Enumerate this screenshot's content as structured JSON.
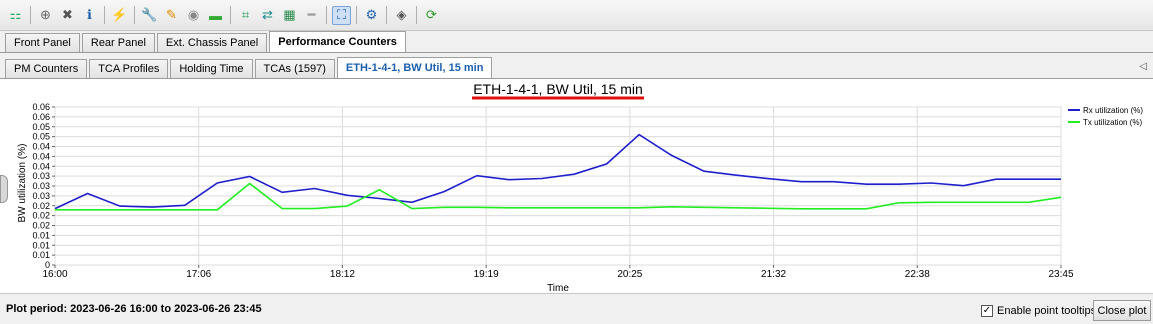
{
  "toolbar": {
    "icons": [
      "network-tree-icon",
      "add-icon",
      "delete-icon",
      "info-icon",
      "lightning-icon",
      "wrench-icon",
      "paint-icon",
      "grey-icon",
      "module-icon",
      "expand-icon",
      "shuffle-icon",
      "ports-icon",
      "bar-icon",
      "chart-icon",
      "refresh-settings-icon",
      "cube-icon",
      "sync-icon"
    ]
  },
  "main_tabs": [
    "Front Panel",
    "Rear Panel",
    "Ext. Chassis Panel",
    "Performance Counters"
  ],
  "sub_tabs": [
    "PM Counters",
    "TCA Profiles",
    "Holding Time",
    "TCAs (1597)",
    "ETH-1-4-1, BW Util, 15 min"
  ],
  "footer": {
    "period": "Plot period: 2023-06-26 16:00 to 2023-06-26 23:45",
    "tooltip_label": "Enable point tooltips",
    "close_label": "Close plot"
  },
  "chart_data": {
    "type": "line",
    "title": "ETH-1-4-1, BW Util, 15 min",
    "xlabel": "Time",
    "ylabel": "BW utilization (%)",
    "x_ticks": [
      "16:00",
      "17:06",
      "18:12",
      "19:19",
      "20:25",
      "21:32",
      "22:38",
      "23:45"
    ],
    "y_ticks": [
      "0",
      "0.01",
      "0.01",
      "0.01",
      "0.02",
      "0.02",
      "0.02",
      "0.03",
      "0.03",
      "0.03",
      "0.04",
      "0.04",
      "0.04",
      "0.05",
      "0.05",
      "0.06",
      "0.06"
    ],
    "ylim": [
      0,
      0.063
    ],
    "x": [
      "16:00",
      "16:15",
      "16:30",
      "16:45",
      "17:00",
      "17:15",
      "17:30",
      "17:45",
      "18:00",
      "18:15",
      "18:30",
      "18:45",
      "19:00",
      "19:15",
      "19:30",
      "19:45",
      "20:00",
      "20:15",
      "20:30",
      "20:45",
      "21:00",
      "21:15",
      "21:30",
      "21:45",
      "22:00",
      "22:15",
      "22:30",
      "22:45",
      "23:00",
      "23:15",
      "23:30",
      "23:45"
    ],
    "series": [
      {
        "name": "Rx utilization (%)",
        "color": "#1f1fcc",
        "values": [
          0.0225,
          0.0285,
          0.0235,
          0.0231,
          0.0238,
          0.0327,
          0.0353,
          0.029,
          0.0305,
          0.0278,
          0.0265,
          0.025,
          0.0293,
          0.0356,
          0.034,
          0.0345,
          0.0362,
          0.0403,
          0.052,
          0.0437,
          0.0374,
          0.0358,
          0.0344,
          0.0332,
          0.0332,
          0.0322,
          0.0322,
          0.0327,
          0.0316,
          0.0342,
          0.0342,
          0.0342
        ]
      },
      {
        "name": "Tx utilization (%)",
        "color": "#22ee22",
        "values": [
          0.022,
          0.022,
          0.022,
          0.022,
          0.022,
          0.022,
          0.0325,
          0.0225,
          0.0225,
          0.0235,
          0.03,
          0.0225,
          0.023,
          0.023,
          0.0228,
          0.0228,
          0.0228,
          0.0228,
          0.0228,
          0.0232,
          0.023,
          0.0228,
          0.0226,
          0.0224,
          0.0224,
          0.0224,
          0.0248,
          0.025,
          0.025,
          0.025,
          0.025,
          0.027
        ]
      }
    ],
    "legend_position": "top-right",
    "grid": true
  }
}
